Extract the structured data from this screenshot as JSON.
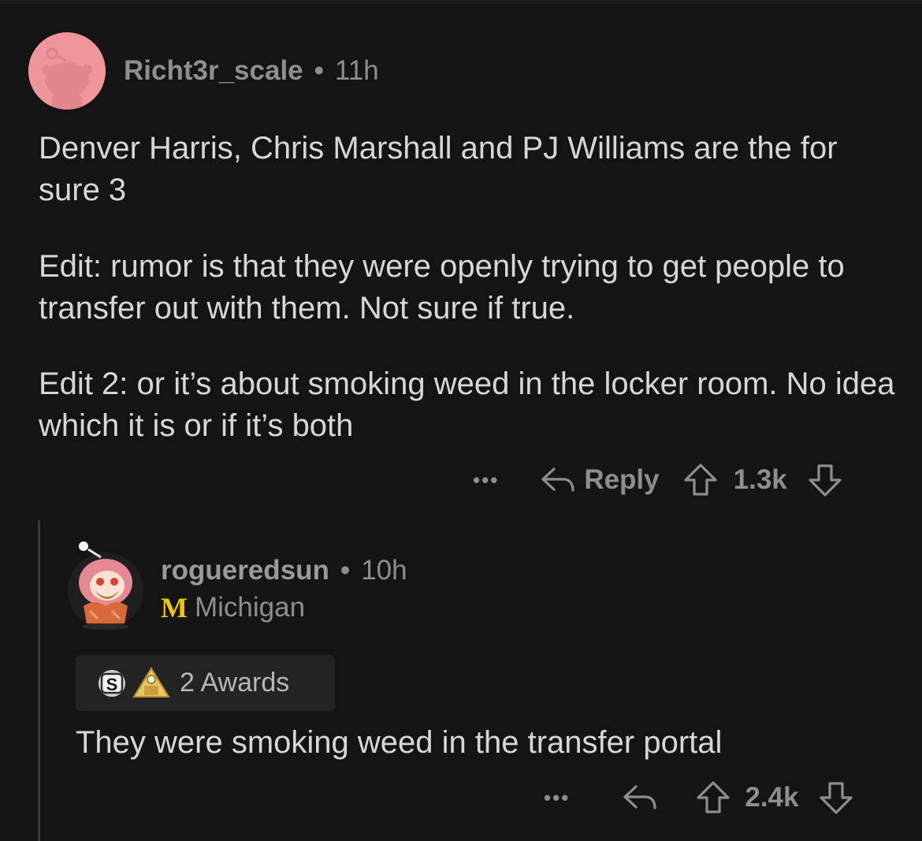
{
  "comment": {
    "username": "Richt3r_scale",
    "separator": "•",
    "time": "11h",
    "paragraphs": [
      "Denver Harris, Chris Marshall and PJ Williams are the for sure 3",
      "Edit: rumor is that they were openly trying to get people to transfer out with them. Not sure if true.",
      "Edit 2: or it’s about smoking weed in the locker room. No idea which it is or if it’s both"
    ],
    "actions": {
      "more": "•••",
      "reply_label": "Reply",
      "score": "1.3k"
    }
  },
  "reply": {
    "username": "roguered sun",
    "username_display": "rogueredsun",
    "separator": "•",
    "time": "10h",
    "flair_badge": "M",
    "flair_text": "Michigan",
    "awards_label": "2 Awards",
    "text": "They were smoking weed in the transfer portal",
    "actions": {
      "more": "•••",
      "score": "2.4k"
    }
  },
  "icons": {
    "avatar1": "snoo-avatar",
    "avatar2": "snoo-avatar-hooded",
    "reply": "reply-arrow-icon",
    "upvote": "upvote-arrow-icon",
    "downvote": "downvote-arrow-icon",
    "award1": "silver-award-icon",
    "award2": "gold-award-icon"
  },
  "colors": {
    "background": "#141414",
    "text": "#d7d7d7",
    "muted": "#8e8e8e",
    "avatar_pink": "#f0969b",
    "flair_yellow": "#f2c500"
  }
}
